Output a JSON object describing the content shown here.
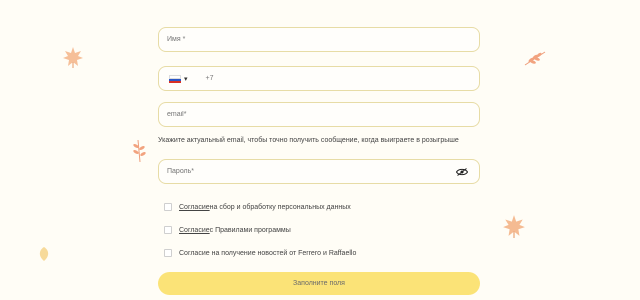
{
  "form": {
    "name_placeholder": "Имя *",
    "phone": {
      "country_flag": "flag-russia-icon",
      "code": "+7"
    },
    "email_placeholder": "email*",
    "email_hint": "Укажите актуальный email, чтобы точно получить сообщение, когда выиграете в розыгрыше",
    "password_placeholder": "Пароль*",
    "consents": [
      {
        "link": "Согласие",
        "text": " на сбор и обработку персональных данных"
      },
      {
        "link": "Согласие",
        "text": " с Правилами программы"
      },
      {
        "link": "",
        "text": "Согласие на получение новостей от Ferrero и Raffaello"
      }
    ],
    "submit_label": "Заполните поля"
  },
  "colors": {
    "background": "#fffdf6",
    "field_border": "#e7dca6",
    "button": "#fbe377",
    "leaf": "#f2a97a"
  }
}
